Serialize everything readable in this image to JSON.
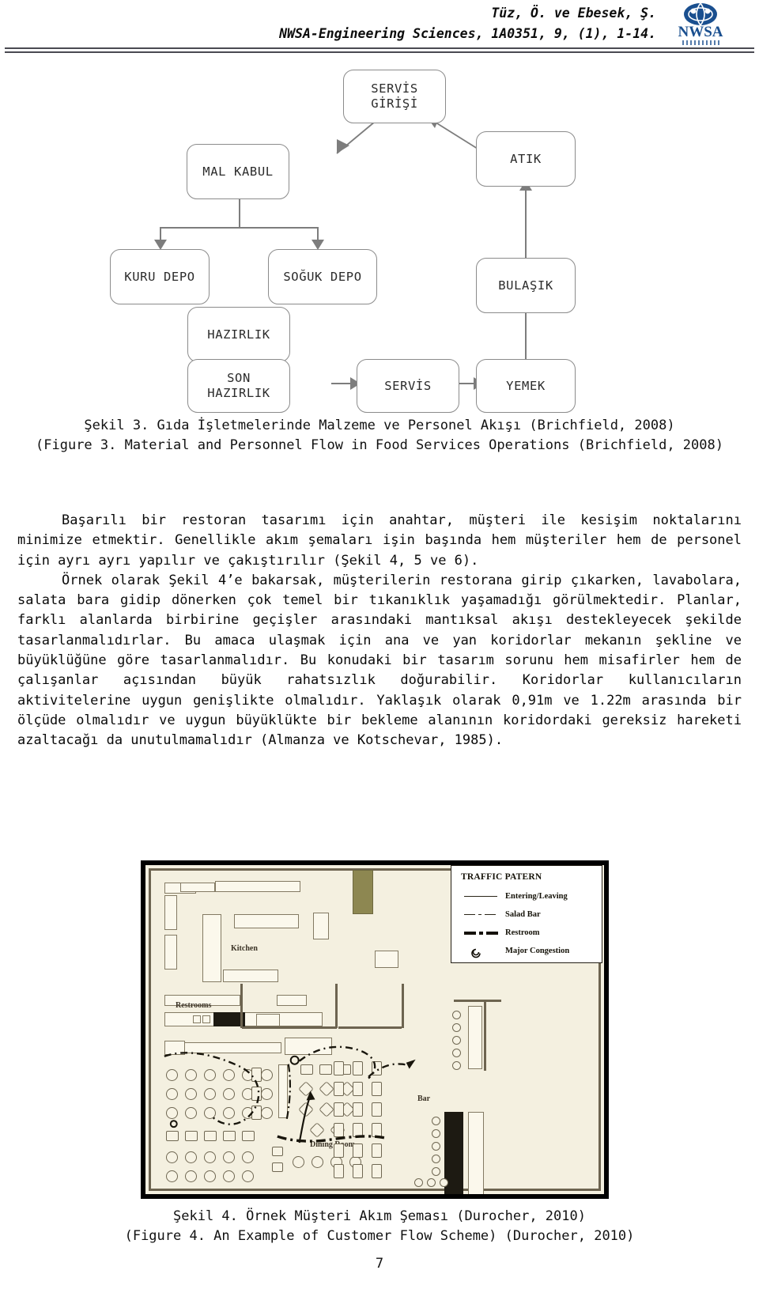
{
  "header": {
    "line1": "Tüz, Ö. ve Ebesek, Ş.",
    "line2": "NWSA-Engineering Sciences, 1A0351, 9, (1), 1-14.",
    "logo_text": "NWSA"
  },
  "figure3": {
    "nodes": [
      {
        "id": "servis-girisi",
        "label": "SERVİS\nGİRİŞİ"
      },
      {
        "id": "mal-kabul",
        "label": "MAL KABUL"
      },
      {
        "id": "atik",
        "label": "ATIK"
      },
      {
        "id": "kuru-depo",
        "label": "KURU DEPO"
      },
      {
        "id": "soguk-depo",
        "label": "SOĞUK DEPO"
      },
      {
        "id": "bulasik",
        "label": "BULAŞIK"
      },
      {
        "id": "hazirlik",
        "label": "HAZIRLIK"
      },
      {
        "id": "son-hazirlik",
        "label": "SON\nHAZIRLIK"
      },
      {
        "id": "servis",
        "label": "SERVİS"
      },
      {
        "id": "yemek",
        "label": "YEMEK"
      }
    ],
    "caption_tr": "Şekil 3. Gıda İşletmelerinde Malzeme ve Personel Akışı (Brichfield, 2008)",
    "caption_en": "(Figure 3. Material and Personnel Flow in Food Services Operations (Brichfield, 2008)"
  },
  "body": {
    "paragraph1": "Başarılı bir restoran tasarımı için anahtar, müşteri ile kesişim noktalarını minimize etmektir. Genellikle akım şemaları işin başında hem müşteriler hem de personel için ayrı ayrı yapılır ve çakıştırılır (Şekil 4, 5 ve 6).",
    "paragraph2": "Örnek olarak Şekil 4’e bakarsak, müşterilerin restorana girip çıkarken, lavabolara, salata bara gidip dönerken çok temel bir tıkanıklık yaşamadığı görülmektedir. Planlar, farklı alanlarda birbirine geçişler arasındaki mantıksal akışı destekleyecek şekilde tasarlanmalıdırlar. Bu amaca ulaşmak için ana ve yan koridorlar mekanın şekline ve büyüklüğüne göre tasarlanmalıdır. Bu konudaki bir tasarım sorunu hem misafirler hem de çalışanlar açısından büyük rahatsızlık doğurabilir. Koridorlar kullanıcıların aktivitelerine uygun genişlikte olmalıdır. Yaklaşık olarak 0,91m ve 1.22m arasında bir ölçüde olmalıdır ve uygun büyüklükte bir bekleme alanının koridordaki gereksiz hareketi azaltacağı da unutulmamalıdır (Almanza ve Kotschevar, 1985)."
  },
  "figure4": {
    "plan_labels": [
      {
        "id": "kitchen",
        "text": "Kitchen"
      },
      {
        "id": "restrooms",
        "text": "Restrooms"
      },
      {
        "id": "bar",
        "text": "Bar"
      },
      {
        "id": "dining-room",
        "text": "Dining Room"
      }
    ],
    "legend": {
      "title": "TRAFFIC PATERN",
      "items": [
        {
          "key": "solid",
          "label": "Entering/Leaving"
        },
        {
          "key": "dash-dot",
          "label": "Salad Bar"
        },
        {
          "key": "thick-dash-dot",
          "label": "Restroom"
        },
        {
          "key": "spiral",
          "label": "Major Congestion"
        }
      ]
    },
    "caption_tr": "Şekil 4. Örnek Müşteri Akım Şeması (Durocher, 2010)",
    "caption_en": "(Figure 4. An Example of Customer Flow Scheme) (Durocher, 2010)"
  },
  "page": {
    "number": "7"
  },
  "colors": {
    "rule": "#4a4a52",
    "node_border": "#8b8b8b",
    "connector": "#7d7d7d",
    "logo_blue": "#1a4f8f",
    "plan_paper": "#f4f0e0"
  }
}
